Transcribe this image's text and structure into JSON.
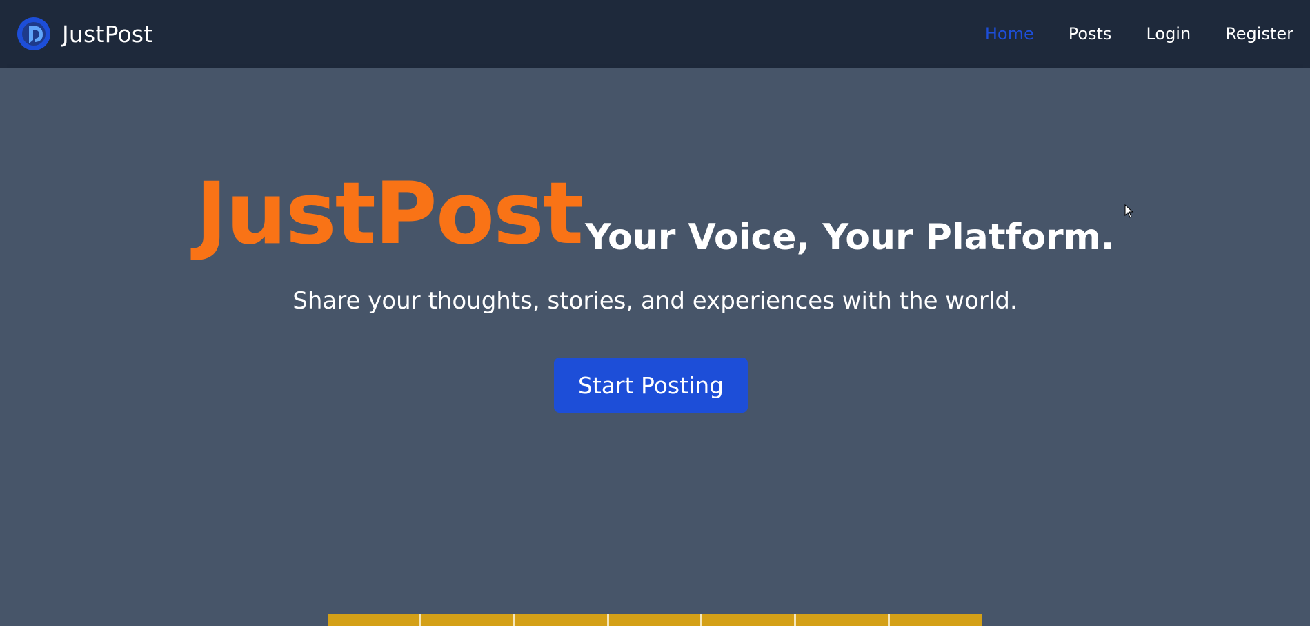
{
  "navbar": {
    "brand_name": "JustPost",
    "links": [
      {
        "label": "Home",
        "active": true
      },
      {
        "label": "Posts",
        "active": false
      },
      {
        "label": "Login",
        "active": false
      },
      {
        "label": "Register",
        "active": false
      }
    ]
  },
  "hero": {
    "brand": "JustPost",
    "tagline": "Your Voice, Your Platform.",
    "subtitle": "Share your thoughts, stories, and experiences with the world.",
    "cta_label": "Start Posting"
  },
  "colors": {
    "navbar_bg": "#1e293b",
    "page_bg": "#475569",
    "accent_orange": "#f97316",
    "accent_blue": "#1d4ed8",
    "strip_yellow": "#d4a017"
  },
  "icons": {
    "brand_logo": "brand-logo-icon",
    "cursor": "mouse-cursor-icon"
  }
}
